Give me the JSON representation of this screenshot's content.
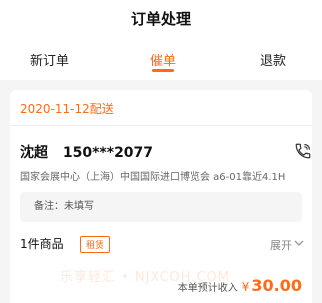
{
  "header": {
    "title": "订单处理"
  },
  "tabs": [
    {
      "label": "新订单"
    },
    {
      "label": "催单"
    },
    {
      "label": "退款"
    }
  ],
  "order": {
    "date_label": "2020-11-12配送",
    "customer_name": "沈超",
    "customer_phone": "150***2077",
    "address": "国家会展中心（上海）中国国际进口博览会 a6-01靠近4.1H",
    "note": "备注：未填写",
    "items_label": "1件商品",
    "tag": "租赁",
    "expand_label": "展开",
    "income_label": "本单预计收入",
    "currency": "¥",
    "income_amount": "30.00"
  },
  "watermark": "乐享轻汇 • NJXCOH.COM",
  "colors": {
    "accent": "#ff6a13"
  }
}
